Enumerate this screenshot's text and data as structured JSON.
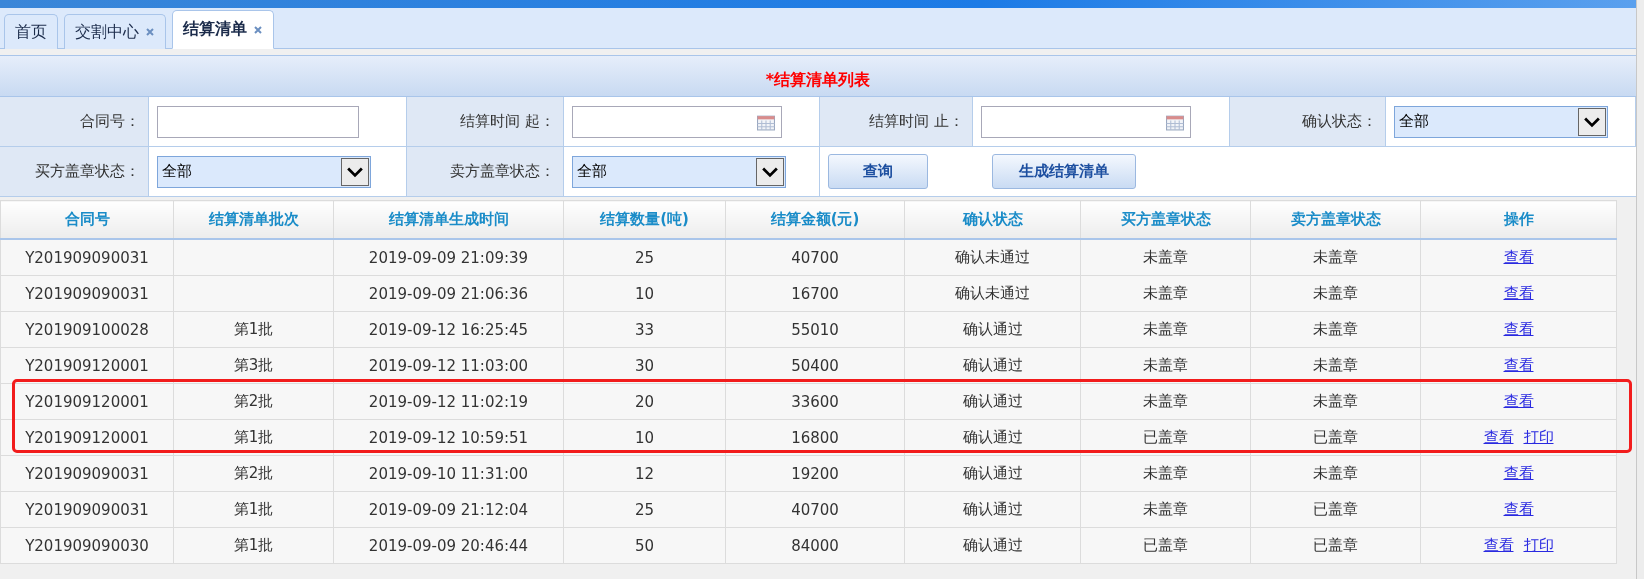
{
  "tabs": [
    {
      "label": "首页",
      "closable": false,
      "selected": false
    },
    {
      "label": "交割中心",
      "closable": true,
      "selected": false
    },
    {
      "label": "结算清单",
      "closable": true,
      "selected": true
    }
  ],
  "panel_title": "*结算清单列表",
  "filters": [
    {
      "label": "合同号：",
      "kind": "text"
    },
    {
      "label": "结算时间 起：",
      "kind": "date"
    },
    {
      "label": "结算时间 止：",
      "kind": "date"
    },
    {
      "label": "确认状态：",
      "kind": "select",
      "value": "全部"
    },
    {
      "label": "买方盖章状态：",
      "kind": "select",
      "value": "全部"
    },
    {
      "label": "卖方盖章状态：",
      "kind": "select",
      "value": "全部"
    }
  ],
  "buttons": [
    "查询",
    "生成结算清单"
  ],
  "table": {
    "columns": [
      "合同号",
      "结算清单批次",
      "结算清单生成时间",
      "结算数量(吨)",
      "结算金额(元)",
      "确认状态",
      "买方盖章状态",
      "卖方盖章状态",
      "操作"
    ],
    "rows": [
      {
        "cells": [
          "Y201909090031",
          "",
          "2019-09-09 21:09:39",
          "25",
          "40700",
          "确认未通过",
          "未盖章",
          "未盖章"
        ],
        "actions": [
          "查看"
        ],
        "highlighted": false
      },
      {
        "cells": [
          "Y201909090031",
          "",
          "2019-09-09 21:06:36",
          "10",
          "16700",
          "确认未通过",
          "未盖章",
          "未盖章"
        ],
        "actions": [
          "查看"
        ],
        "highlighted": false
      },
      {
        "cells": [
          "Y201909100028",
          "第1批",
          "2019-09-12 16:25:45",
          "33",
          "55010",
          "确认通过",
          "未盖章",
          "未盖章"
        ],
        "actions": [
          "查看"
        ],
        "highlighted": false
      },
      {
        "cells": [
          "Y201909120001",
          "第3批",
          "2019-09-12 11:03:00",
          "30",
          "50400",
          "确认通过",
          "未盖章",
          "未盖章"
        ],
        "actions": [
          "查看"
        ],
        "highlighted": false
      },
      {
        "cells": [
          "Y201909120001",
          "第2批",
          "2019-09-12 11:02:19",
          "20",
          "33600",
          "确认通过",
          "未盖章",
          "未盖章"
        ],
        "actions": [
          "查看"
        ],
        "highlighted": true
      },
      {
        "cells": [
          "Y201909120001",
          "第1批",
          "2019-09-12 10:59:51",
          "10",
          "16800",
          "确认通过",
          "已盖章",
          "已盖章"
        ],
        "actions": [
          "查看",
          "打印"
        ],
        "highlighted": true
      },
      {
        "cells": [
          "Y201909090031",
          "第2批",
          "2019-09-10 11:31:00",
          "12",
          "19200",
          "确认通过",
          "未盖章",
          "未盖章"
        ],
        "actions": [
          "查看"
        ],
        "highlighted": false
      },
      {
        "cells": [
          "Y201909090031",
          "第1批",
          "2019-09-09 21:12:04",
          "25",
          "40700",
          "确认通过",
          "未盖章",
          "已盖章"
        ],
        "actions": [
          "查看"
        ],
        "highlighted": false
      },
      {
        "cells": [
          "Y201909090030",
          "第1批",
          "2019-09-09 20:46:44",
          "50",
          "84000",
          "确认通过",
          "已盖章",
          "已盖章"
        ],
        "actions": [
          "查看",
          "打印"
        ],
        "highlighted": false
      }
    ]
  }
}
